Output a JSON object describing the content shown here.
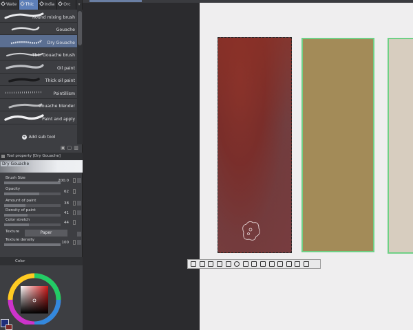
{
  "tabs": [
    {
      "label": "Wate",
      "active": false
    },
    {
      "label": "Thic",
      "active": true
    },
    {
      "label": "India",
      "active": false
    },
    {
      "label": "Orc",
      "active": false
    }
  ],
  "brushes": [
    {
      "label": "Round mixing brush",
      "selected": false
    },
    {
      "label": "Gouache",
      "selected": false
    },
    {
      "label": "Dry Gouache",
      "selected": true
    },
    {
      "label": "Thin Gouache brush",
      "selected": false
    },
    {
      "label": "Oil paint",
      "selected": false
    },
    {
      "label": "Thick oil paint",
      "selected": false
    },
    {
      "label": "Pointillism",
      "selected": false
    },
    {
      "label": "Gouache blender",
      "selected": false
    },
    {
      "label": "Paint and apply",
      "selected": false
    }
  ],
  "add_sub_tool": "Add sub tool",
  "tool_property": {
    "title": "Tool property [Dry Gouache]",
    "preview_label": "Dry Gouache",
    "props": [
      {
        "label": "Brush Size",
        "value": "200.0",
        "fill": 1.0
      },
      {
        "label": "Opacity",
        "value": "62",
        "fill": 0.62
      },
      {
        "label": "Amount of paint",
        "value": "38",
        "fill": 0.38
      },
      {
        "label": "Density of paint",
        "value": "41",
        "fill": 0.41
      },
      {
        "label": "Color stretch",
        "value": "44",
        "fill": 0.44
      }
    ],
    "texture_label": "Texture",
    "texture_value": "Paper",
    "texture_density_label": "Texture density",
    "texture_density_value": "100"
  },
  "color_panel": {
    "title": "Color",
    "fg_color": "#1f2f7a",
    "bg_color": "#7d2828"
  },
  "canvas": {
    "rect_colors": [
      "#7a2a25",
      "#a38b58",
      "#d7cdbf"
    ],
    "selection_color": "#6fd086"
  }
}
